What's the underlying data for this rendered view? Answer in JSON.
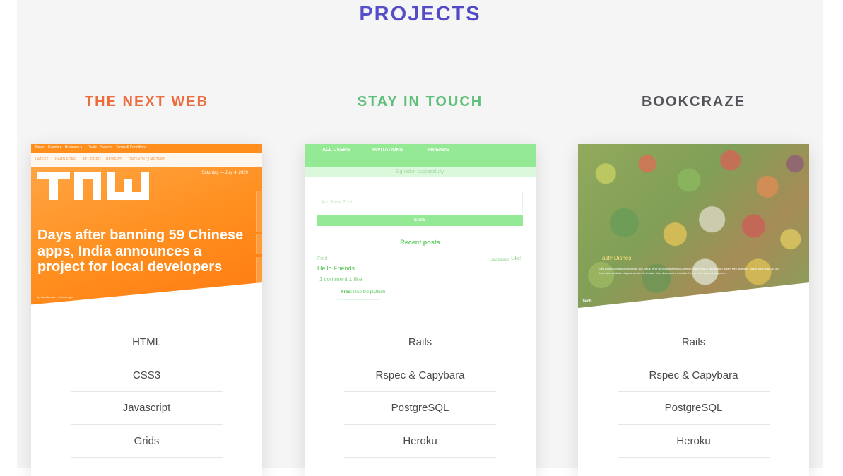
{
  "section": {
    "title": "PROJECTS"
  },
  "projects": [
    {
      "name": "THE NEXT WEB",
      "name_color": "#ee6b3c",
      "screenshot": {
        "top_nav": [
          "News",
          "Events ▾",
          "Business ▾",
          "Deals",
          "Search",
          "Terms & Conditions"
        ],
        "sub_nav": [
          "LATEST",
          "HARD FORK",
          "PLUGGED",
          "REVIEWS",
          "GROWTH QUARTERS"
        ],
        "date": "Saturday — July 4, 2020",
        "logo": "TNW",
        "headline": "Days after banning 59 Chinese apps, India announces a project for local developers",
        "byline": "by Ivan Mehta  ·  4 hours ago"
      },
      "tech": [
        "HTML",
        "CSS3",
        "Javascript",
        "Grids"
      ]
    },
    {
      "name": "STAY IN TOUCH",
      "name_color": "#5fbf7a",
      "screenshot": {
        "nav": [
          "ALL USERS",
          "INVITATIONS",
          "FRIENDS"
        ],
        "flash": "Signed in successfully.",
        "input_placeholder": "Add New Post",
        "save_label": "SAVE",
        "recent_posts": "Recent posts",
        "post_author": "Fred",
        "post_date": "2020/06/12",
        "like_label": "Like!",
        "post_title": "Hello Friends",
        "post_meta": "1 comment  1 like",
        "comment_author": "Fred:",
        "comment_text": "I like the platform"
      },
      "tech": [
        "Rails",
        "Rspec & Capybara",
        "PostgreSQL",
        "Heroku"
      ]
    },
    {
      "name": "BOOKCRAZE",
      "name_color": "#56525a",
      "screenshot": {
        "article_title": "Tasty Dishes",
        "article_text": "Sed ut perspiciatis unde omnis iste natus error sit voluptatem accusantium doloremque laudantium, totam rem aperiam, eaque ipsa quae ab illo inventore veritatis et quasi architecto beatae vitae dicta sunt explicabo. Nemo enim ipsam voluptatem.",
        "category": "Tech"
      },
      "tech": [
        "Rails",
        "Rspec & Capybara",
        "PostgreSQL",
        "Heroku"
      ]
    }
  ]
}
